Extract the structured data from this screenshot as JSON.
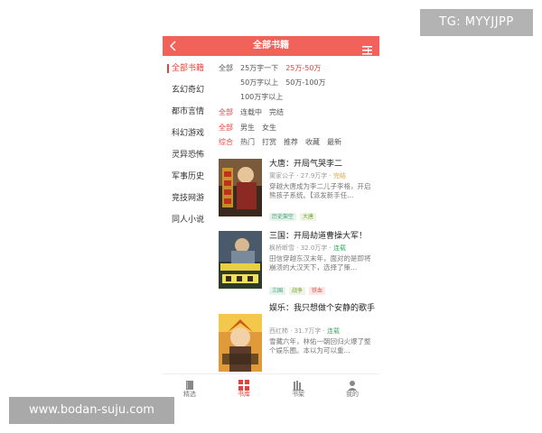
{
  "watermarks": {
    "top_right": "TG: MYYJJPP",
    "bottom_left": "www.bodan-suju.com"
  },
  "header": {
    "title": "全部书籍",
    "back_icon": "chevron-left-icon",
    "menu_icon": "list-icon"
  },
  "sidebar": {
    "items": [
      {
        "label": "全部书籍",
        "active": true
      },
      {
        "label": "玄幻奇幻"
      },
      {
        "label": "都市言情"
      },
      {
        "label": "科幻游戏"
      },
      {
        "label": "灵异恐怖"
      },
      {
        "label": "军事历史"
      },
      {
        "label": "竞技网游"
      },
      {
        "label": "同人小说"
      }
    ]
  },
  "filters": {
    "wordcount": {
      "all": "全部",
      "options": [
        "25万字一下",
        "25万-50万",
        "50万字以上",
        "50万-100万",
        "100万字以上"
      ],
      "selected": "25万-50万"
    },
    "status": {
      "all": "全部",
      "options": [
        "连载中",
        "完结"
      ]
    },
    "gender": {
      "all": "全部",
      "options": [
        "男生",
        "女生"
      ]
    },
    "sort": {
      "lead": "综合",
      "options": [
        "热门",
        "打赏",
        "推荐",
        "收藏",
        "最新"
      ]
    }
  },
  "books": [
    {
      "title": "大唐：开局气哭李二",
      "author": "寓家公子",
      "words": "27.9万字",
      "status": "完结",
      "desc": "穿越大唐成为李二儿子李格，开启熊孩子系统。【派发新手任...",
      "tags": [
        "历史架空",
        "大唐"
      ]
    },
    {
      "title": "三国：开局劫道曹操大军！",
      "author": "枫桥断雪",
      "words": "32.0万字",
      "status": "连载",
      "desc": "田信穿越东汉末年，面对的是即将崩溃的大汉天下，选择了策...",
      "tags": [
        "三国",
        "战争",
        "铁血"
      ]
    },
    {
      "title": "娱乐：我只想做个安静的歌手",
      "author": "西红柿",
      "words": "31.7万字",
      "status": "连载",
      "desc": "雪藏六年，林佑一朝回归火爆了整个娱乐圈。本以为可以重..."
    }
  ],
  "tabbar": {
    "items": [
      {
        "label": "精选",
        "icon": "book-icon"
      },
      {
        "label": "书库",
        "icon": "grid-icon",
        "active": true
      },
      {
        "label": "书架",
        "icon": "shelf-icon"
      },
      {
        "label": "我的",
        "icon": "user-icon"
      }
    ]
  },
  "colors": {
    "accent": "#e8413a",
    "header": "#f0625a",
    "status_done": "#f2a33a",
    "status_serial": "#4aa86a"
  }
}
